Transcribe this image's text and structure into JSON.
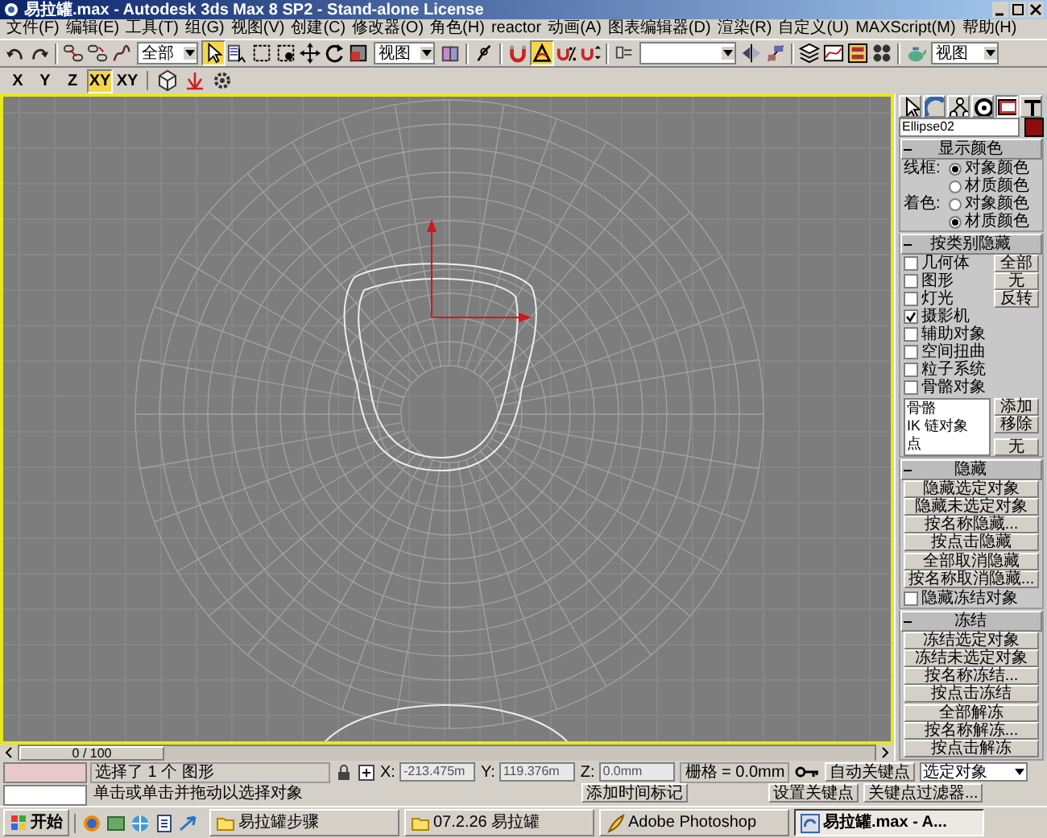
{
  "window": {
    "title": "易拉罐.max - Autodesk 3ds Max 8 SP2  - Stand-alone License"
  },
  "menu": [
    "文件(F)",
    "编辑(E)",
    "工具(T)",
    "组(G)",
    "视图(V)",
    "创建(C)",
    "修改器(O)",
    "角色(H)",
    "reactor",
    "动画(A)",
    "图表编辑器(D)",
    "渲染(R)",
    "自定义(U)",
    "MAXScript(M)",
    "帮助(H)"
  ],
  "main_toolbar": {
    "items": [
      {
        "kind": "tool",
        "selected": false
      },
      {
        "kind": "tool",
        "selected": false
      },
      {
        "kind": "separator"
      },
      {
        "kind": "tool",
        "selected": false
      },
      {
        "kind": "tool",
        "selected": false
      },
      {
        "kind": "tool",
        "selected": false
      },
      {
        "kind": "dropdown",
        "value": "全部"
      },
      {
        "kind": "tool",
        "selected": true
      },
      {
        "kind": "tool",
        "selected": false
      },
      {
        "kind": "tool",
        "selected": false
      },
      {
        "kind": "tool",
        "selected": false
      },
      {
        "kind": "tool",
        "selected": false
      },
      {
        "kind": "tool",
        "selected": false
      },
      {
        "kind": "tool",
        "selected": false
      },
      {
        "kind": "dropdown",
        "value": "视图"
      },
      {
        "kind": "tool",
        "selected": false
      },
      {
        "kind": "separator"
      },
      {
        "kind": "tool",
        "selected": false
      },
      {
        "kind": "separator"
      },
      {
        "kind": "tool",
        "selected": false
      },
      {
        "kind": "tool",
        "selected": true
      },
      {
        "kind": "tool",
        "selected": false
      },
      {
        "kind": "tool",
        "selected": false
      },
      {
        "kind": "separator"
      },
      {
        "kind": "tool",
        "selected": false
      },
      {
        "kind": "dropdown",
        "value": ""
      },
      {
        "kind": "tool",
        "selected": false
      },
      {
        "kind": "tool",
        "selected": false
      },
      {
        "kind": "separator"
      },
      {
        "kind": "tool",
        "selected": false
      },
      {
        "kind": "tool",
        "selected": false
      },
      {
        "kind": "tool",
        "selected": false
      },
      {
        "kind": "tool",
        "selected": false
      },
      {
        "kind": "separator"
      },
      {
        "kind": "tool",
        "selected": false
      },
      {
        "kind": "dropdown",
        "value": "视图"
      }
    ]
  },
  "axis_toolbar": {
    "axes": [
      {
        "label": "X",
        "selected": false
      },
      {
        "label": "Y",
        "selected": false
      },
      {
        "label": "Z",
        "selected": false
      },
      {
        "label": "XY",
        "selected": true
      },
      {
        "label": "XY",
        "selected": false
      }
    ],
    "tools": [
      {
        "selected": false
      },
      {
        "selected": false
      },
      {
        "selected": false
      }
    ]
  },
  "viewport": {
    "active": true
  },
  "time_slider": {
    "label": "0 / 100",
    "level": 0
  },
  "command_panel": {
    "tabs": [
      {
        "selected": false
      },
      {
        "selected": false
      },
      {
        "selected": false
      },
      {
        "selected": false
      },
      {
        "selected": true
      },
      {
        "selected": false
      }
    ],
    "object": {
      "name": "Ellipse02",
      "color": "#8c0d0d"
    },
    "rollouts": [
      {
        "kind": "display_color",
        "title": "显示颜色",
        "expanded": true,
        "groups": [
          {
            "label": "线框:",
            "options": [
              {
                "label": "对象颜色",
                "selected": true
              },
              {
                "label": "材质颜色",
                "selected": false
              }
            ]
          },
          {
            "label": "着色:",
            "options": [
              {
                "label": "对象颜色",
                "selected": false
              },
              {
                "label": "材质颜色",
                "selected": true
              }
            ]
          }
        ]
      },
      {
        "kind": "category",
        "title": "按类别隐藏",
        "expanded": true,
        "checkboxes": [
          {
            "label": "几何体",
            "checked": false
          },
          {
            "label": "图形",
            "checked": false
          },
          {
            "label": "灯光",
            "checked": false
          },
          {
            "label": "摄影机",
            "checked": true
          },
          {
            "label": "辅助对象",
            "checked": false
          },
          {
            "label": "空间扭曲",
            "checked": false
          },
          {
            "label": "粒子系统",
            "checked": false
          },
          {
            "label": "骨骼对象",
            "checked": false
          }
        ],
        "buttons": [
          "全部",
          "无",
          "反转"
        ],
        "list": [
          "骨骼",
          "IK 链对象",
          "点"
        ],
        "list_buttons": [
          "添加",
          "移除",
          "无"
        ]
      },
      {
        "kind": "buttons",
        "title": "隐藏",
        "expanded": true,
        "groups": [
          [
            "隐藏选定对象",
            "隐藏未选定对象",
            "按名称隐藏...",
            "按点击隐藏"
          ],
          [
            "全部取消隐藏",
            "按名称取消隐藏..."
          ]
        ],
        "checkboxes": [
          {
            "label": "隐藏冻结对象",
            "checked": false
          }
        ]
      },
      {
        "kind": "buttons",
        "title": "冻结",
        "expanded": true,
        "groups": [
          [
            "冻结选定对象",
            "冻结未选定对象",
            "按名称冻结...",
            "按点击冻结"
          ],
          [
            "全部解冻",
            "按名称解冻...",
            "按点击解冻"
          ]
        ]
      }
    ]
  },
  "status_bar": {
    "selection": "选择了 1 个 图形",
    "prompt": "单击或单击并拖动以选择对象",
    "coords": [
      {
        "label": "X:",
        "value": "-213.475m"
      },
      {
        "label": "Y:",
        "value": "119.376m"
      },
      {
        "label": "Z:",
        "value": "0.0mm"
      }
    ],
    "grid": "栅格 = 0.0mm",
    "add_time_tag": "添加时间标记",
    "auto_key": "自动关键点",
    "key_mode": "选定对象",
    "set_key": "设置关键点",
    "key_filters": "关键点过滤器..."
  },
  "taskbar": {
    "start": "开始",
    "tasks": [
      {
        "kind": "folder",
        "label": "易拉罐步骤",
        "selected": false
      },
      {
        "kind": "folder",
        "label": "07.2.26 易拉罐",
        "selected": false
      },
      {
        "kind": "editor",
        "label": "Adobe Photoshop",
        "selected": false
      },
      {
        "kind": "modeler",
        "label": "易拉罐.max - A...",
        "selected": true
      }
    ]
  }
}
